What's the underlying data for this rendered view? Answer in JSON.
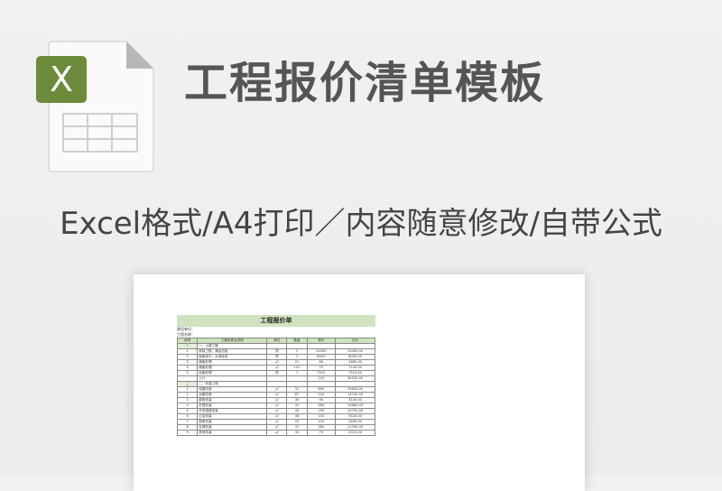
{
  "header": {
    "title": "工程报价清单模板",
    "subtitle": "Excel格式/A4打印／内容随意修改/自带公式"
  },
  "icon": {
    "name": "excel-file-icon",
    "badge_letter": "X",
    "badge_color": "#6b8a3a"
  },
  "sheet": {
    "title": "工程报价单",
    "meta": [
      "建设单位：",
      "工程名称："
    ],
    "columns": [
      "序号",
      "工程名称及说明",
      "单位",
      "数量",
      "单价",
      "合价"
    ],
    "rows": [
      [
        "一",
        "一、土建工程",
        "",
        "",
        "",
        ""
      ],
      [
        "1",
        "拆除工程，清运垃圾",
        "项",
        "1",
        "12000",
        "12000.00"
      ],
      [
        "2",
        "地面找平，水泥砂浆",
        "项",
        "1",
        "6000",
        "6000.00"
      ],
      [
        "3",
        "墙面处理",
        "㎡",
        "21",
        "80",
        "1680.00"
      ],
      [
        "4",
        "墙面处理",
        "㎡",
        "102",
        "70",
        "7140.00"
      ],
      [
        "5",
        "地面处理",
        "项",
        "1",
        "7510",
        "7510.00"
      ],
      [
        "",
        "小计",
        "",
        "",
        "小计",
        "34330.00"
      ],
      [
        "二",
        "二、安装工程",
        "",
        "",
        "",
        ""
      ],
      [
        "1",
        "电路改造",
        "㎡",
        "31",
        "890",
        "29890.00"
      ],
      [
        "2",
        "水路改造",
        "㎡",
        "67",
        "220",
        "14740.00"
      ],
      [
        "3",
        "弱电安装",
        "㎡",
        "35",
        "90",
        "3150.00"
      ],
      [
        "4",
        "灯具安装",
        "㎡",
        "31",
        "480",
        "14880.00"
      ],
      [
        "5",
        "开关插座安装",
        "㎡",
        "43",
        "250",
        "10750.00"
      ],
      [
        "6",
        "卫浴安装",
        "㎡",
        "38",
        "140",
        "5320.00"
      ],
      [
        "7",
        "厨房安装",
        "㎡",
        "22",
        "120",
        "2640.00"
      ],
      [
        "8",
        "空调安装",
        "㎡",
        "31",
        "380",
        "11780.00"
      ],
      [
        "9",
        "其他安装",
        "㎡",
        "33",
        "70",
        "2310.00"
      ]
    ]
  }
}
